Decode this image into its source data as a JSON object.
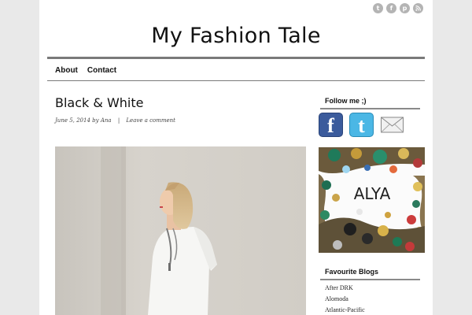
{
  "header": {
    "site_title": "My Fashion Tale",
    "social_icons": [
      "twitter-icon",
      "facebook-icon",
      "pinterest-icon",
      "rss-icon"
    ]
  },
  "nav": {
    "items": [
      {
        "label": "About"
      },
      {
        "label": "Contact"
      }
    ]
  },
  "post": {
    "title": "Black & White",
    "date": "June 5, 2014",
    "by_text": "by",
    "author": "Ana",
    "separator": "|",
    "comment_link": "Leave a comment"
  },
  "sidebar": {
    "follow_title": "Follow me ;)",
    "follow_icons": [
      "facebook-icon",
      "twitter-icon",
      "email-icon"
    ],
    "banner_text": "ALYA",
    "favourite_title": "Favourite Blogs",
    "blogs": [
      {
        "label": "After DRK"
      },
      {
        "label": "Alomoda"
      },
      {
        "label": "Atlantic-Pacific"
      }
    ]
  },
  "colors": {
    "background": "#e9e9e9",
    "page": "#ffffff",
    "rule": "#7a7a7a",
    "facebook": "#3b5b9c",
    "twitter": "#4bb7e5"
  }
}
